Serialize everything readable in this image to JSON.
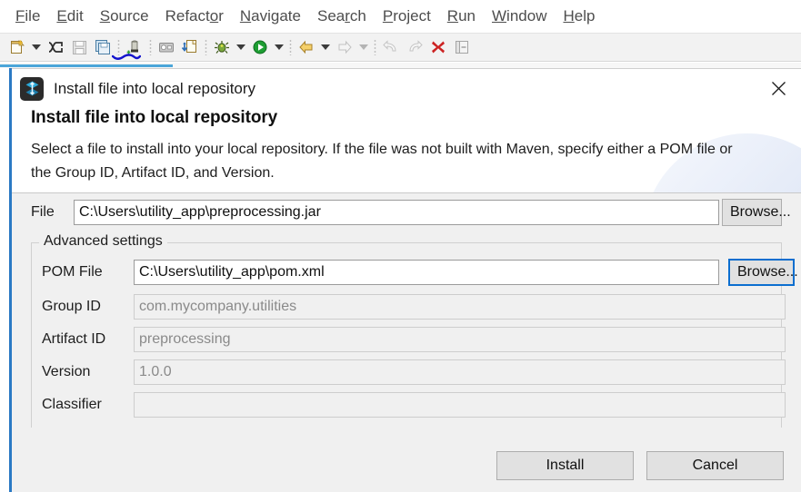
{
  "ide": {
    "menu": [
      {
        "label": "File",
        "mnemonic_index": 0,
        "name": "menu-file"
      },
      {
        "label": "Edit",
        "mnemonic_index": 0,
        "name": "menu-edit"
      },
      {
        "label": "Source",
        "mnemonic_index": 0,
        "name": "menu-source"
      },
      {
        "label": "Refactor",
        "mnemonic_index": 6,
        "name": "menu-refactor"
      },
      {
        "label": "Navigate",
        "mnemonic_index": 0,
        "name": "menu-navigate"
      },
      {
        "label": "Search",
        "mnemonic_index": 3,
        "name": "menu-search"
      },
      {
        "label": "Project",
        "mnemonic_index": 0,
        "name": "menu-project"
      },
      {
        "label": "Run",
        "mnemonic_index": 0,
        "name": "menu-run"
      },
      {
        "label": "Window",
        "mnemonic_index": 0,
        "name": "menu-window"
      },
      {
        "label": "Help",
        "mnemonic_index": 0,
        "name": "menu-help"
      }
    ],
    "toolbar": {
      "icons": [
        "new-file-icon",
        "new-file-dropdown-icon",
        "link-editor-icon",
        "save-icon",
        "save-all-icon",
        "maven-install-icon",
        "print-icon",
        "export-icon",
        "debug-icon",
        "debug-dropdown-icon",
        "run-icon",
        "run-dropdown-icon",
        "back-icon",
        "back-dropdown-icon",
        "forward-icon",
        "forward-dropdown-icon",
        "undo-icon",
        "redo-icon",
        "terminate-icon",
        "panel-icon"
      ],
      "annotation_color": "#1414cd"
    }
  },
  "dialog": {
    "title": "Install file into local repository",
    "icon": "maven-icon",
    "close_label": "×",
    "heading": "Install file into local repository",
    "description": "Select a file to install into your local repository. If the file was not built with Maven, specify either a POM file or the Group ID, Artifact ID, and Version.",
    "file": {
      "label": "File",
      "value": "C:\\Users\\utility_app\\preprocessing.jar",
      "browse_label": "Browse...",
      "enabled": true,
      "focused": false
    },
    "advanced": {
      "group_label": "Advanced settings",
      "pom": {
        "label": "POM File",
        "value": "C:\\Users\\utility_app\\pom.xml",
        "browse_label": "Browse...",
        "enabled": true,
        "browse_focused": true
      },
      "fields": [
        {
          "label": "Group ID",
          "value": "com.mycompany.utilities",
          "enabled": false
        },
        {
          "label": "Artifact ID",
          "value": "preprocessing",
          "enabled": false
        },
        {
          "label": "Version",
          "value": "1.0.0",
          "enabled": false
        },
        {
          "label": "Classifier",
          "value": "",
          "enabled": false
        }
      ]
    },
    "buttons": {
      "install_label": "Install",
      "cancel_label": "Cancel"
    },
    "colors": {
      "focus_blue": "#0b6ecf",
      "dialog_bg": "#f0f0f0",
      "header_bg": "#ffffff",
      "deco_blue": "#d4def1",
      "rail_blue": "#2a79c4"
    }
  }
}
